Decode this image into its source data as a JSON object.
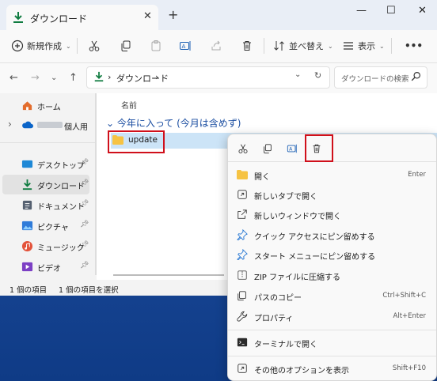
{
  "tab": {
    "title": "ダウンロード",
    "close": "✕",
    "new_tab": "+"
  },
  "window_controls": {
    "minimize": "—",
    "maximize": "☐",
    "close": "✕"
  },
  "toolbar": {
    "new_label": "新規作成",
    "sort_label": "並べ替え",
    "view_label": "表示",
    "more_label": "•••"
  },
  "address": {
    "crumb": "ダウンロード",
    "sep1": "›",
    "sep2": "›"
  },
  "search": {
    "placeholder": "ダウンロードの検索"
  },
  "sidebar": {
    "items": [
      {
        "label": "ホーム"
      },
      {
        "label": "個人用"
      },
      {
        "label": "デスクトップ"
      },
      {
        "label": "ダウンロード"
      },
      {
        "label": "ドキュメント"
      },
      {
        "label": "ピクチャ"
      },
      {
        "label": "ミュージック"
      },
      {
        "label": "ビデオ"
      }
    ]
  },
  "content": {
    "column_name": "名前",
    "group_header": "今年に入って (今月は含めず)",
    "file_name": "update"
  },
  "status": {
    "count": "1 個の項目",
    "selected": "1 個の項目を選択"
  },
  "context_menu": {
    "items": [
      {
        "label": "開く",
        "shortcut": "Enter"
      },
      {
        "label": "新しいタブで開く",
        "shortcut": ""
      },
      {
        "label": "新しいウィンドウで開く",
        "shortcut": ""
      },
      {
        "label": "クイック アクセスにピン留めする",
        "shortcut": ""
      },
      {
        "label": "スタート メニューにピン留めする",
        "shortcut": ""
      },
      {
        "label": "ZIP ファイルに圧縮する",
        "shortcut": ""
      },
      {
        "label": "パスのコピー",
        "shortcut": "Ctrl+Shift+C"
      },
      {
        "label": "プロパティ",
        "shortcut": "Alt+Enter"
      },
      {
        "label": "ターミナルで開く",
        "shortcut": ""
      },
      {
        "label": "その他のオプションを表示",
        "shortcut": "Shift+F10"
      }
    ]
  },
  "colors": {
    "accent": "#0067c0",
    "highlight": "#d0101b",
    "selection": "#cce4f7",
    "download_green": "#107c41"
  }
}
